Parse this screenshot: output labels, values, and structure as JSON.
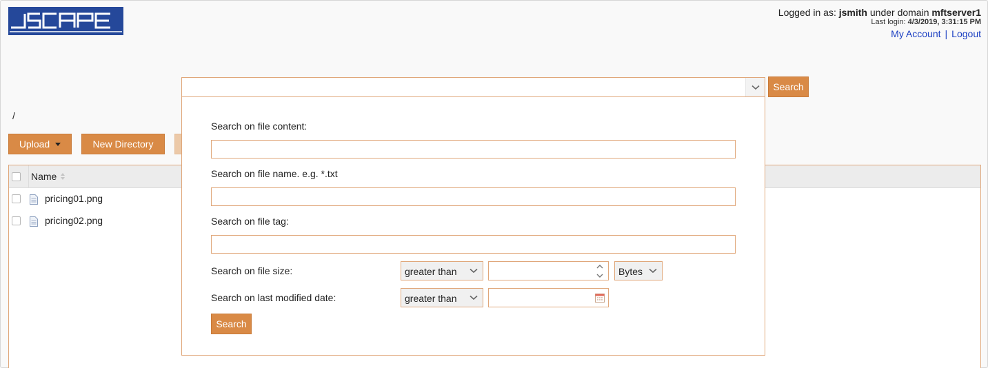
{
  "brand": {
    "logo_text": "JSCAPE",
    "logo_color": "#25489a",
    "accent": "#d98a46"
  },
  "header": {
    "logged_in_prefix": "Logged in as:",
    "username": "jsmith",
    "domain_prefix": "under domain",
    "domain": "mftserver1",
    "last_login_label": "Last login:",
    "last_login_value": "4/3/2019, 3:31:15 PM",
    "my_account": "My Account",
    "separator": "|",
    "logout": "Logout"
  },
  "path": "/",
  "toolbar": {
    "upload_label": "Upload",
    "new_directory_label": "New Directory"
  },
  "table": {
    "name_header": "Name",
    "rows": [
      {
        "name": "pricing01.png",
        "icon": "file-icon"
      },
      {
        "name": "pricing02.png",
        "icon": "file-icon"
      }
    ]
  },
  "search": {
    "query_value": "",
    "button_label": "Search",
    "panel": {
      "content_label": "Search on file content:",
      "content_value": "",
      "name_label": "Search on file name. e.g. *.txt",
      "name_value": "",
      "tag_label": "Search on file tag:",
      "tag_value": "",
      "size_label": "Search on file size:",
      "size_operator": "greater than",
      "size_value": "",
      "size_unit": "Bytes",
      "date_label": "Search on last modified date:",
      "date_operator": "greater than",
      "date_value": "",
      "submit_label": "Search"
    }
  }
}
